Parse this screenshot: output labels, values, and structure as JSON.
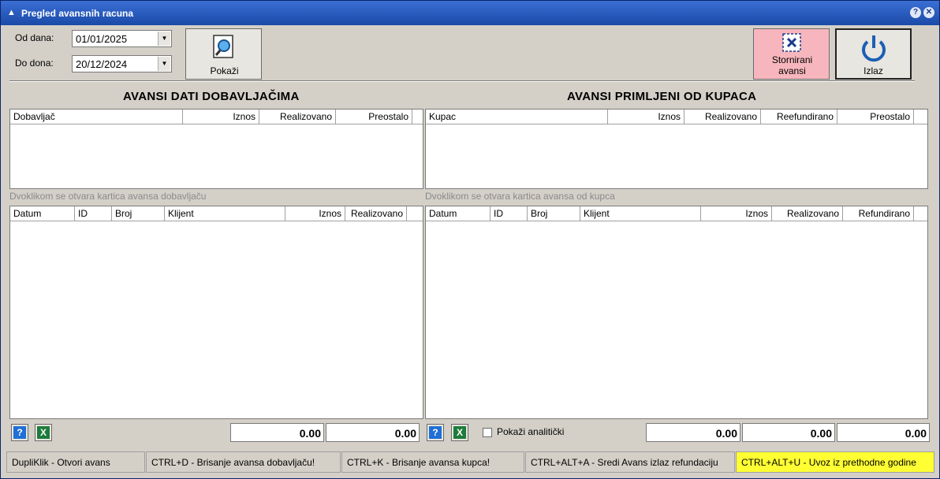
{
  "window": {
    "title": "Pregled avansnih racuna",
    "help_button": "?",
    "close_button": "✕"
  },
  "filters": {
    "from_label": "Od dana:",
    "from_value": "01/01/2025",
    "to_label": "Do dona:",
    "to_value": "20/12/2024"
  },
  "toolbar": {
    "show_label": "Pokaži",
    "cancelled_label_1": "Stornirani",
    "cancelled_label_2": "avansi",
    "exit_label": "Izlaz"
  },
  "suppliers": {
    "title": "AVANSI DATI DOBAVLJAČIMA",
    "summary_columns": [
      "Dobavljač",
      "Iznos",
      "Realizovano",
      "Preostalo"
    ],
    "hint": "Dvoklikom se otvara kartica avansa dobavljaču",
    "detail_columns": [
      "Datum",
      "ID",
      "Broj",
      "Klijent",
      "Iznos",
      "Realizovano"
    ],
    "total_1": "0.00",
    "total_2": "0.00"
  },
  "customers": {
    "title": "AVANSI PRIMLJENI OD KUPACA",
    "summary_columns": [
      "Kupac",
      "Iznos",
      "Realizovano",
      "Reefundirano",
      "Preostalo"
    ],
    "hint": "Dvoklikom se otvara kartica avansa od kupca",
    "detail_columns": [
      "Datum",
      "ID",
      "Broj",
      "Klijent",
      "Iznos",
      "Realizovano",
      "Refundirano"
    ],
    "show_analytics_label": "Pokaži analitički",
    "show_analytics_checked": false,
    "total_1": "0.00",
    "total_2": "0.00",
    "total_3": "0.00"
  },
  "buttons": {
    "help_icon_text": "?",
    "excel_icon_text": "X"
  },
  "statusbar": [
    "DupliKlik - Otvori avans",
    "CTRL+D - Brisanje avansa dobavljaču!",
    "CTRL+K - Brisanje avansa kupca!",
    "CTRL+ALT+A - Sredi Avans izlaz refundaciju",
    "CTRL+ALT+U - Uvoz iz prethodne godine"
  ],
  "colors": {
    "title_bar": "#1a4aa8",
    "cancelled_button": "#f7b6bd",
    "highlight_status": "#ffff33"
  }
}
